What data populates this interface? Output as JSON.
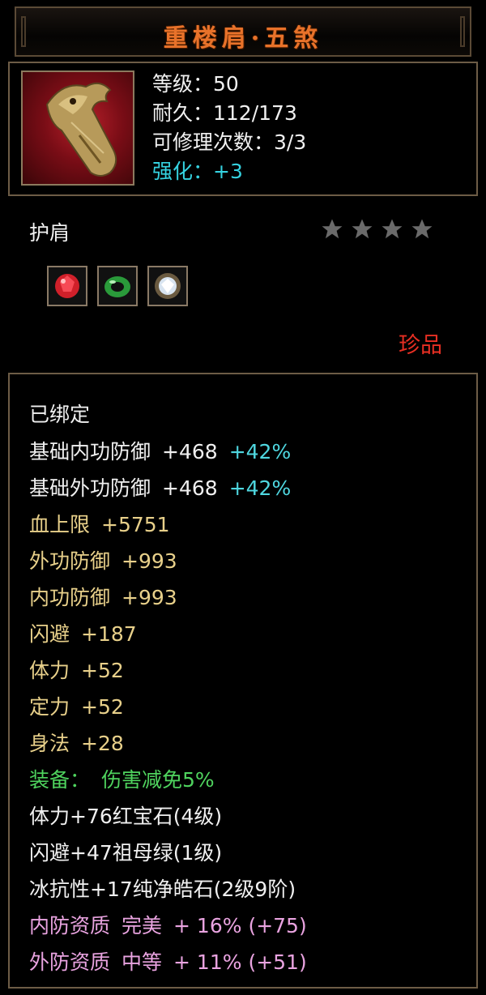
{
  "header": {
    "title": "重楼肩·五煞"
  },
  "item": {
    "level": "等级：50",
    "durability": "耐久：112/173",
    "repair": "可修理次数：3/3",
    "enhance": "强化：+3",
    "type": "护肩",
    "stars_filled": 0,
    "stars_total": 4,
    "quality": "珍品",
    "gems": [
      "ruby-gem-icon",
      "emerald-gem-icon",
      "diamond-gem-icon"
    ]
  },
  "attributes": {
    "bound": "已绑定",
    "base_inner_label": "基础内功防御",
    "base_inner_value": "+468",
    "base_inner_pct": "+42%",
    "base_outer_label": "基础外功防御",
    "base_outer_value": "+468",
    "base_outer_pct": "+42%",
    "hp": "血上限",
    "hp_val": "+5751",
    "outer_def": "外功防御",
    "outer_def_val": "+993",
    "inner_def": "内功防御",
    "inner_def_val": "+993",
    "dodge": "闪避",
    "dodge_val": "+187",
    "stamina": "体力",
    "stamina_val": "+52",
    "focus": "定力",
    "focus_val": "+52",
    "agility": "身法",
    "agility_val": "+28",
    "equip_label": "装备：",
    "equip_effect": "伤害减免5%",
    "gem1": "体力+76红宝石(4级)",
    "gem2": "闪避+47祖母绿(1级)",
    "gem3": "冰抗性+17纯净皓石(2级9阶)",
    "q1_label": "内防资质",
    "q1_grade": "完美",
    "q1_val": "+ 16% (+75)",
    "q2_label": "外防资质",
    "q2_grade": "中等",
    "q2_val": "+ 11% (+51)"
  },
  "colors": {
    "title": "#e8722a",
    "enhance": "#35d2e0",
    "quality": "#e82f23",
    "attr_gold": "#e8d08a",
    "equip_green": "#4fd35e",
    "aptitude_pink": "#e9a3e0"
  }
}
